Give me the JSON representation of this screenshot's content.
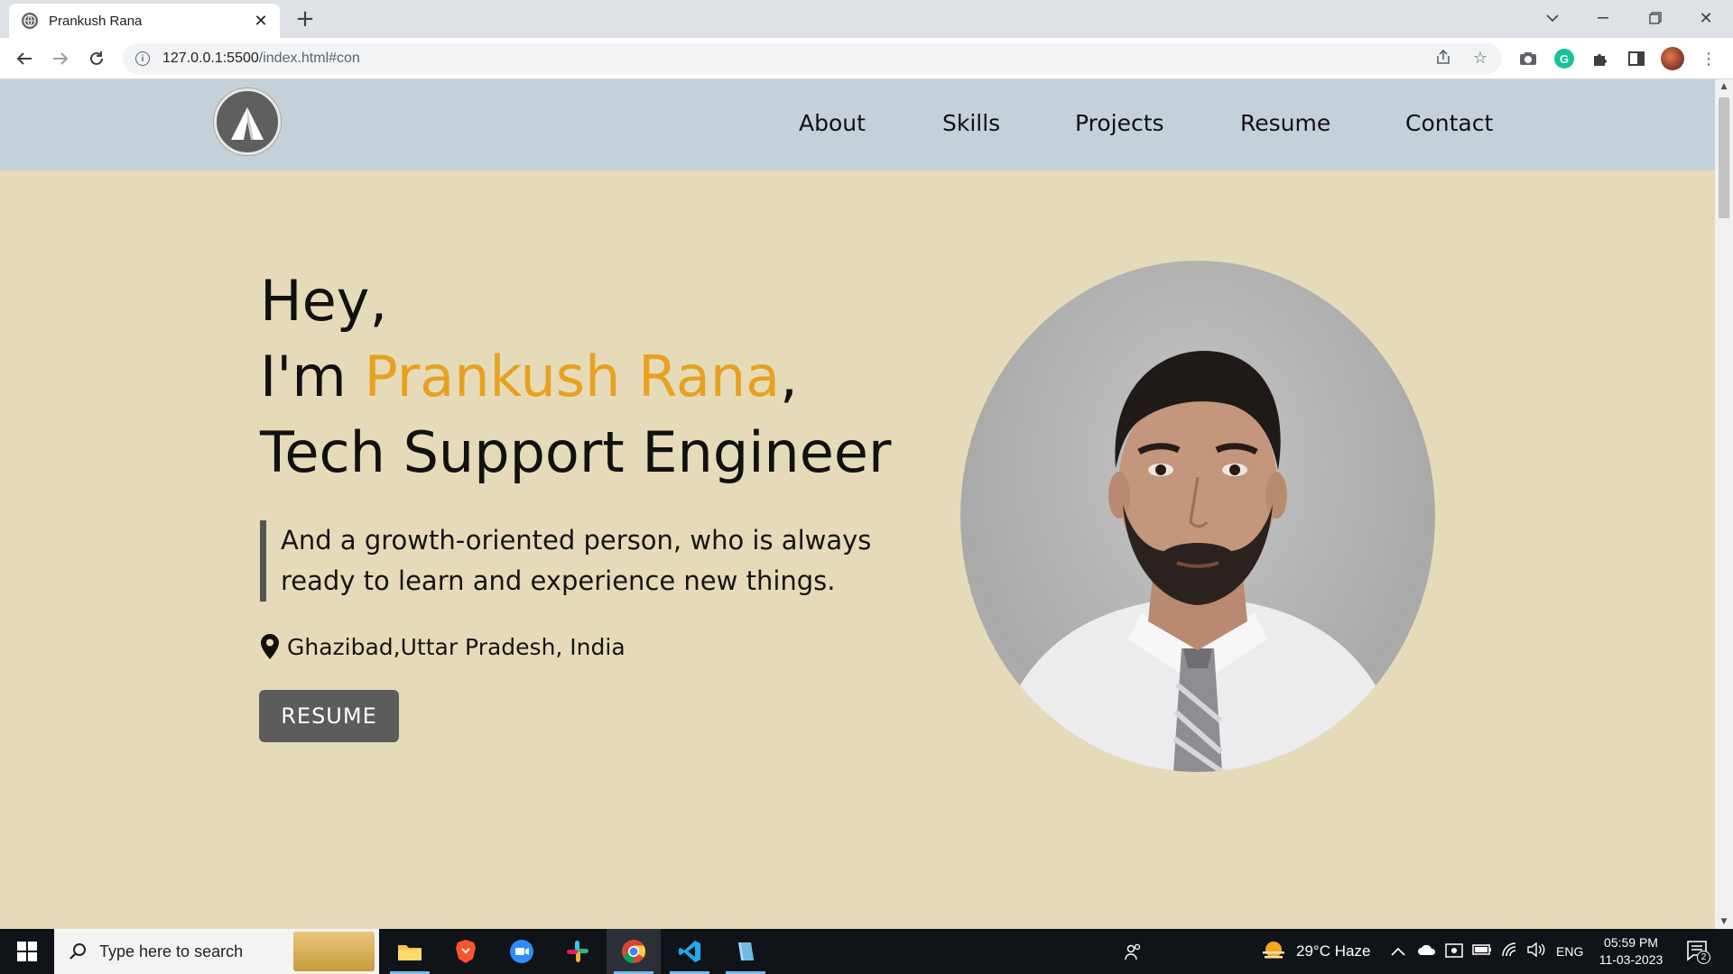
{
  "browser": {
    "tab_title": "Prankush Rana",
    "new_tab": "+",
    "url_host": "127.0.0.1:5500",
    "url_path": "/index.html#con"
  },
  "site": {
    "nav": [
      "About",
      "Skills",
      "Projects",
      "Resume",
      "Contact"
    ],
    "hero": {
      "greeting": "Hey,",
      "im": "I'm ",
      "name": "Prankush Rana",
      "comma": ",",
      "role": "Tech Support Engineer",
      "quote_line1": "And a growth-oriented person, who is always",
      "quote_line2": "ready to learn and experience new things.",
      "location": "Ghazibad,Uttar Pradesh, India",
      "button": "RESUME"
    },
    "accent_color": "#e8a11f",
    "background_color": "#e6dbb9",
    "header_color": "#c5d1d9"
  },
  "taskbar": {
    "search_placeholder": "Type here to search",
    "weather": "29°C  Haze",
    "lang": "ENG",
    "time": "05:59 PM",
    "date": "11-03-2023",
    "notifications": "2"
  }
}
